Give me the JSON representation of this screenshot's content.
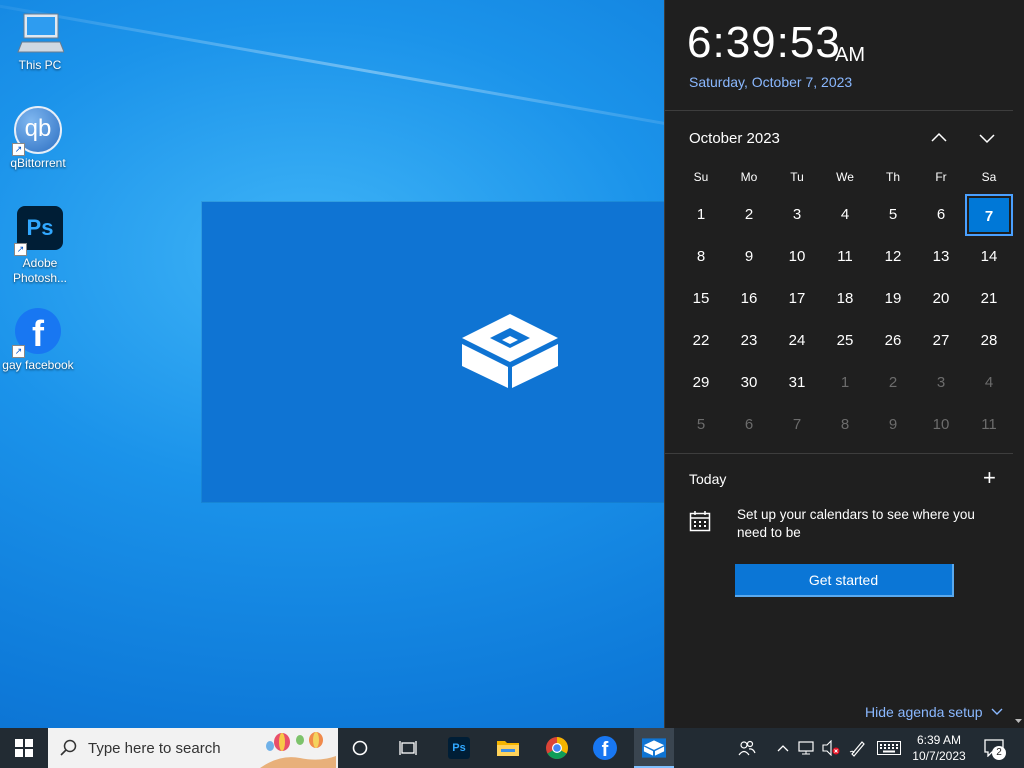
{
  "desktop": {
    "icons": [
      {
        "label": "This PC",
        "icon": "computer-icon"
      },
      {
        "label": "qBittorrent",
        "icon": "qbittorrent-icon",
        "glyph": "qb"
      },
      {
        "label": "Adobe Photosh...",
        "icon": "photoshop-icon",
        "glyph": "Ps"
      },
      {
        "label": "gay facebook",
        "icon": "facebook-icon",
        "glyph": "f"
      }
    ]
  },
  "flyout": {
    "time": "6:39:53",
    "ampm": "AM",
    "date": "Saturday, October 7, 2023",
    "month_label": "October 2023",
    "weekdays": [
      "Su",
      "Mo",
      "Tu",
      "We",
      "Th",
      "Fr",
      "Sa"
    ],
    "weeks": [
      [
        "1",
        "2",
        "3",
        "4",
        "5",
        "6",
        "7"
      ],
      [
        "8",
        "9",
        "10",
        "11",
        "12",
        "13",
        "14"
      ],
      [
        "15",
        "16",
        "17",
        "18",
        "19",
        "20",
        "21"
      ],
      [
        "22",
        "23",
        "24",
        "25",
        "26",
        "27",
        "28"
      ],
      [
        "29",
        "30",
        "31",
        "1",
        "2",
        "3",
        "4"
      ],
      [
        "5",
        "6",
        "7",
        "8",
        "9",
        "10",
        "11"
      ]
    ],
    "today_value": "7",
    "agenda": {
      "today_label": "Today",
      "add_label": "+",
      "setup_text": "Set up your calendars to see where you need to be",
      "get_started_label": "Get started",
      "hide_label": "Hide agenda setup"
    }
  },
  "taskbar": {
    "search_placeholder": "Type here to search",
    "tray_time": "6:39 AM",
    "tray_date": "10/7/2023",
    "notification_count": "2",
    "pinned": [
      "cortana-icon",
      "task-view-icon",
      "photoshop-icon",
      "file-explorer-icon",
      "chrome-icon",
      "facebook-icon",
      "sandbox-icon"
    ]
  },
  "colors": {
    "accent": "#0078d7",
    "flyout_bg": "#1f1f1f",
    "taskbar_bg": "#222b33",
    "link": "#8ab8ff"
  }
}
